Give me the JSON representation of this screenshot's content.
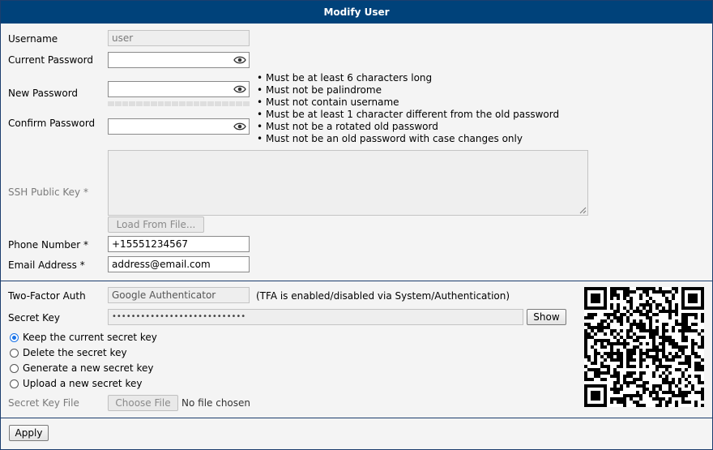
{
  "window": {
    "title": "Modify User"
  },
  "colors": {
    "title_bar": "#00427a",
    "border": "#1c3e6e",
    "radio_accent": "#1a73e8"
  },
  "icons": {
    "password_toggle": "eye-icon",
    "resize_handle": "resize-grip-icon",
    "qr": "qr-code-image"
  },
  "account": {
    "username_label": "Username",
    "username_value": "user",
    "current_password_label": "Current Password",
    "current_password_value": "",
    "new_password_label": "New Password",
    "new_password_value": "",
    "confirm_password_label": "Confirm Password",
    "confirm_password_value": "",
    "password_rules": [
      "Must be at least 6 characters long",
      "Must not be palindrome",
      "Must not contain username",
      "Must be at least 1 character different from the old password",
      "Must not be a rotated old password",
      "Must not be an old password with case changes only"
    ],
    "ssh_key_label": "SSH Public Key *",
    "ssh_key_value": "",
    "load_from_file_label": "Load From File...",
    "phone_label": "Phone Number *",
    "phone_value": "+15551234567",
    "email_label": "Email Address *",
    "email_value": "address@email.com"
  },
  "tfa": {
    "label": "Two-Factor Auth",
    "value": "Google Authenticator",
    "note": "(TFA is enabled/disabled via System/Authentication)",
    "secret_key_label": "Secret Key",
    "secret_key_masked": "••••••••••••••••••••••••••••",
    "show_label": "Show",
    "options": [
      "Keep the current secret key",
      "Delete the secret key",
      "Generate a new secret key",
      "Upload a new secret key"
    ],
    "selected_option": 0,
    "secret_key_file_label": "Secret Key File",
    "choose_file_label": "Choose File",
    "no_file_text": "No file chosen"
  },
  "footer": {
    "apply_label": "Apply"
  }
}
